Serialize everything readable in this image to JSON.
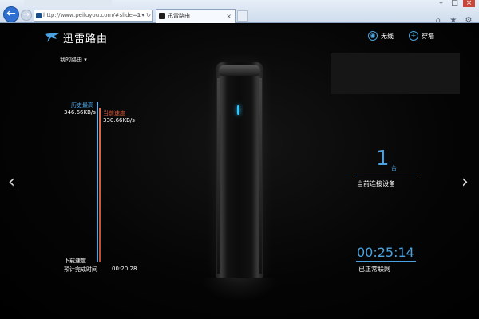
{
  "browser": {
    "url": "http://www.peiluyou.com/#slide=1",
    "url_tools": "ρ ▾ ↻",
    "tab_title": "迅雷路由",
    "tab_close": "×",
    "back": "←",
    "forward": "→",
    "window_controls": [
      "–",
      "□",
      "×"
    ],
    "toolbar_icons": [
      "⌂",
      "★",
      "⚙"
    ]
  },
  "app": {
    "logo_text": "迅雷路由",
    "router_menu": "我的路由 ▾",
    "wireless_label": "无线",
    "wall_label": "穿墙",
    "prev_arrow": "‹",
    "next_arrow": "›",
    "accent_color": "#4aa3e0",
    "current_color": "#e05a3a"
  },
  "speed": {
    "history_max_label": "历史最高",
    "history_max_value": "346.66KB/s",
    "current_label": "当前速度",
    "current_value": "330.66KB/s",
    "download_label": "下载速度",
    "eta_label": "预计完成时间",
    "eta_value": "00:20:28"
  },
  "stats": {
    "device_count": "1",
    "device_unit": "台",
    "device_label": "当前连接设备",
    "online_time": "00:25:14",
    "online_label": "已正常联网"
  }
}
